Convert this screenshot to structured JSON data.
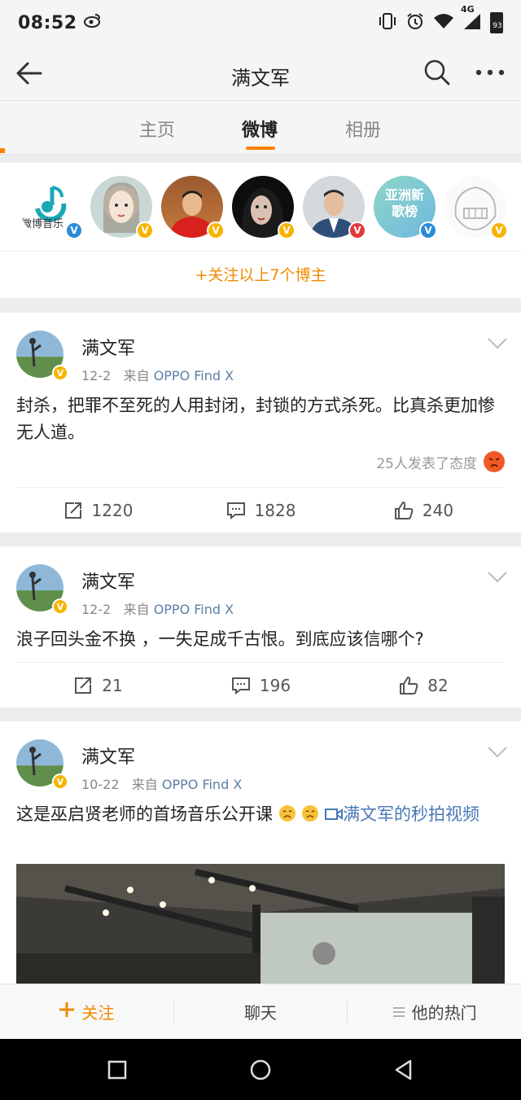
{
  "status": {
    "time": "08:52",
    "network": "4G",
    "battery": "93"
  },
  "nav": {
    "title": "满文军"
  },
  "tabs": [
    {
      "label": "主页"
    },
    {
      "label": "微博"
    },
    {
      "label": "相册"
    }
  ],
  "recommend": {
    "first_avatar_text": "微博音乐",
    "sixth_avatar_text": "亚洲新歌榜",
    "follow_all": "+关注以上7个博主"
  },
  "posts": [
    {
      "author": "满文军",
      "date": "12-2",
      "from": "来自",
      "source": "OPPO Find X",
      "text": "封杀，把罪不至死的人用封闭，封锁的方式杀死。比真杀更加惨无人道。",
      "reaction": "25人发表了态度",
      "reposts": "1220",
      "comments": "1828",
      "likes": "240"
    },
    {
      "author": "满文军",
      "date": "12-2",
      "from": "来自",
      "source": "OPPO Find X",
      "text": "浪子回头金不换 ，一失足成千古恨。到底应该信哪个?",
      "reposts": "21",
      "comments": "196",
      "likes": "82"
    },
    {
      "author": "满文军",
      "date": "10-22",
      "from": "来自",
      "source": "OPPO Find X",
      "text": "这是巫启贤老师的首场音乐公开课",
      "video_link": "满文军的秒拍视频"
    }
  ],
  "bottom": {
    "follow": "关注",
    "chat": "聊天",
    "hot": "他的热门"
  },
  "colors": {
    "accent": "#ff8200",
    "link": "#4a78b6"
  }
}
